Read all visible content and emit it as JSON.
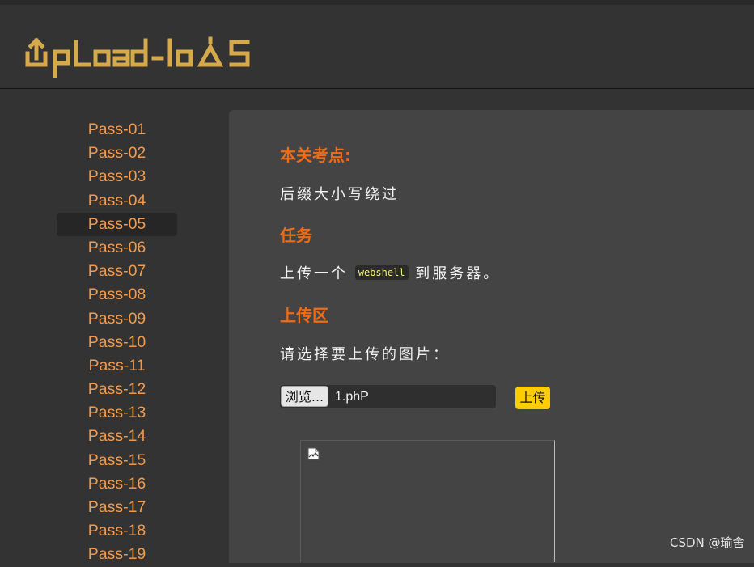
{
  "header": {
    "logo_text": "Upload-labs",
    "logo_icon": "upload-labs-logo"
  },
  "sidebar": {
    "items": [
      {
        "label": "Pass-01"
      },
      {
        "label": "Pass-02"
      },
      {
        "label": "Pass-03"
      },
      {
        "label": "Pass-04"
      },
      {
        "label": "Pass-05"
      },
      {
        "label": "Pass-06"
      },
      {
        "label": "Pass-07"
      },
      {
        "label": "Pass-08"
      },
      {
        "label": "Pass-09"
      },
      {
        "label": "Pass-10"
      },
      {
        "label": "Pass-11"
      },
      {
        "label": "Pass-12"
      },
      {
        "label": "Pass-13"
      },
      {
        "label": "Pass-14"
      },
      {
        "label": "Pass-15"
      },
      {
        "label": "Pass-16"
      },
      {
        "label": "Pass-17"
      },
      {
        "label": "Pass-18"
      },
      {
        "label": "Pass-19"
      }
    ],
    "active_index": 4
  },
  "main": {
    "checkpoint_title": "本关考点:",
    "checkpoint_text": "后缀大小写绕过",
    "task_title": "任务",
    "task_text_before": "上传一个",
    "task_code": "webshell",
    "task_text_after": "到服务器。",
    "upload_title": "上传区",
    "upload_prompt": "请选择要上传的图片：",
    "browse_label": "浏览...",
    "file_name": "1.phP",
    "upload_button": "上传",
    "broken_image_icon": "broken-image-icon"
  },
  "watermark": "CSDN @瑜舍",
  "colors": {
    "accent_orange": "#ef6b14",
    "nav_orange": "#f39b4c",
    "button_yellow": "#ffcc00",
    "logo_gold": "#d6a94a"
  }
}
